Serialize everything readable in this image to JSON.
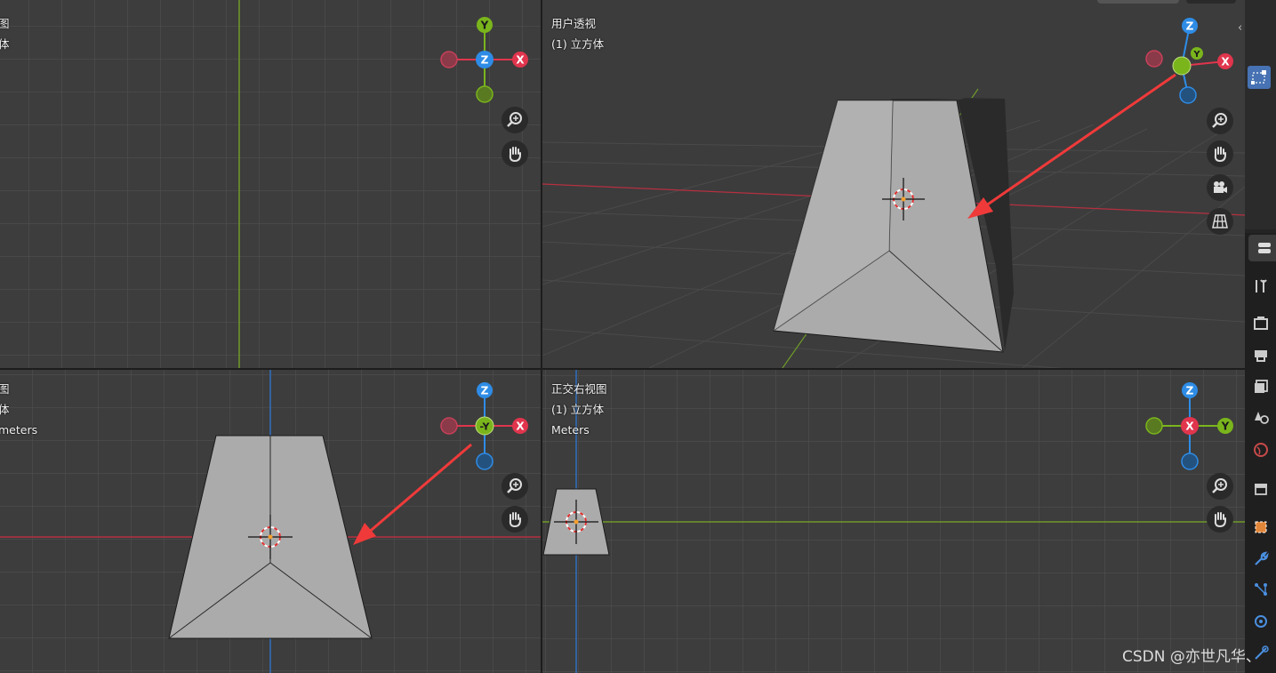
{
  "viewports": {
    "top_left": {
      "view_name": "图",
      "object_name": "体"
    },
    "top_right": {
      "view_name": "用户透视",
      "object_name": "(1) 立方体"
    },
    "bottom_left": {
      "view_name": "图",
      "object_name": "体",
      "units": "meters"
    },
    "bottom_right": {
      "view_name": "正交右视图",
      "object_name": "(1) 立方体",
      "units": "Meters"
    }
  },
  "gizmo_axes": {
    "top_left": {
      "top": "Y",
      "center": "Z",
      "right": "X"
    },
    "top_right": {
      "top": "Z",
      "center": "Y",
      "right": "X"
    },
    "bottom_left": {
      "top": "Z",
      "center": "-Y",
      "right": "X"
    },
    "bottom_right": {
      "top": "Z",
      "center": "X",
      "right": "Y"
    }
  },
  "icons": [
    "zoom-icon",
    "hand-icon",
    "camera-icon",
    "grid-icon",
    "properties-tab-icons"
  ],
  "colors": {
    "x_axis": "#e0354d",
    "y_axis": "#7ab51c",
    "z_axis": "#2e8ce6",
    "annotation_arrow": "#f03a3a",
    "mesh_face": "#ababab",
    "viewport_bg": "#3d3d3d"
  },
  "watermark": "CSDN @亦世凡华、"
}
